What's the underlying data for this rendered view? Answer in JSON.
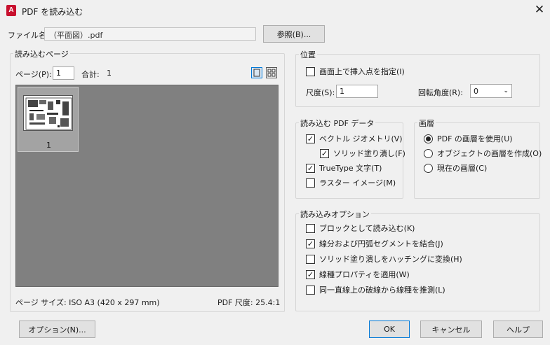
{
  "window": {
    "app_icon_letter": "A",
    "title": "PDF を読み込む"
  },
  "file": {
    "label": "ファイル名:",
    "value": "（平面図）.pdf",
    "browse_label": "参照(B)..."
  },
  "pages": {
    "group_title": "読み込むページ",
    "page_label": "ページ(P):",
    "page_value": "1",
    "total_label": "合計:",
    "total_value": "1",
    "thumbs": [
      {
        "number": "1"
      }
    ],
    "page_size": "ページ サイズ: ISO A3 (420 x 297 mm)",
    "pdf_scale": "PDF 尺度: 25.4:1"
  },
  "position": {
    "group_title": "位置",
    "specify_on_screen": "画面上で挿入点を指定(I)",
    "specify_checked": false,
    "scale_label": "尺度(S):",
    "scale_value": "1",
    "rotation_label": "回転角度(R):",
    "rotation_value": "0"
  },
  "pdf_data": {
    "group_title": "読み込む PDF データ",
    "items": [
      {
        "label": "ベクトル ジオメトリ(V)",
        "checked": true,
        "indent": false
      },
      {
        "label": "ソリッド塗り潰し(F)",
        "checked": true,
        "indent": true
      },
      {
        "label": "TrueType 文字(T)",
        "checked": true,
        "indent": false
      },
      {
        "label": "ラスター イメージ(M)",
        "checked": false,
        "indent": false
      }
    ]
  },
  "layers": {
    "group_title": "画層",
    "items": [
      {
        "label": "PDF の画層を使用(U)",
        "selected": true
      },
      {
        "label": "オブジェクトの画層を作成(O)",
        "selected": false
      },
      {
        "label": "現在の画層(C)",
        "selected": false
      }
    ]
  },
  "import_options": {
    "group_title": "読み込みオプション",
    "items": [
      {
        "label": "ブロックとして読み込む(K)",
        "checked": false
      },
      {
        "label": "線分および円弧セグメントを結合(J)",
        "checked": true
      },
      {
        "label": "ソリッド塗り潰しをハッチングに変換(H)",
        "checked": false
      },
      {
        "label": "線種プロパティを適用(W)",
        "checked": true
      },
      {
        "label": "同一直線上の破線から線種を推測(L)",
        "checked": false
      }
    ]
  },
  "footer": {
    "options_label": "オプション(N)...",
    "ok_label": "OK",
    "cancel_label": "キャンセル",
    "help_label": "ヘルプ"
  },
  "colors": {
    "accent": "#0078d7",
    "app_icon": "#c8102e",
    "preview_bg": "#808080"
  },
  "icons": {
    "close": "close-icon",
    "single_view": "single-page-view-icon",
    "grid_view": "grid-view-icon",
    "dropdown": "chevron-down-icon"
  }
}
